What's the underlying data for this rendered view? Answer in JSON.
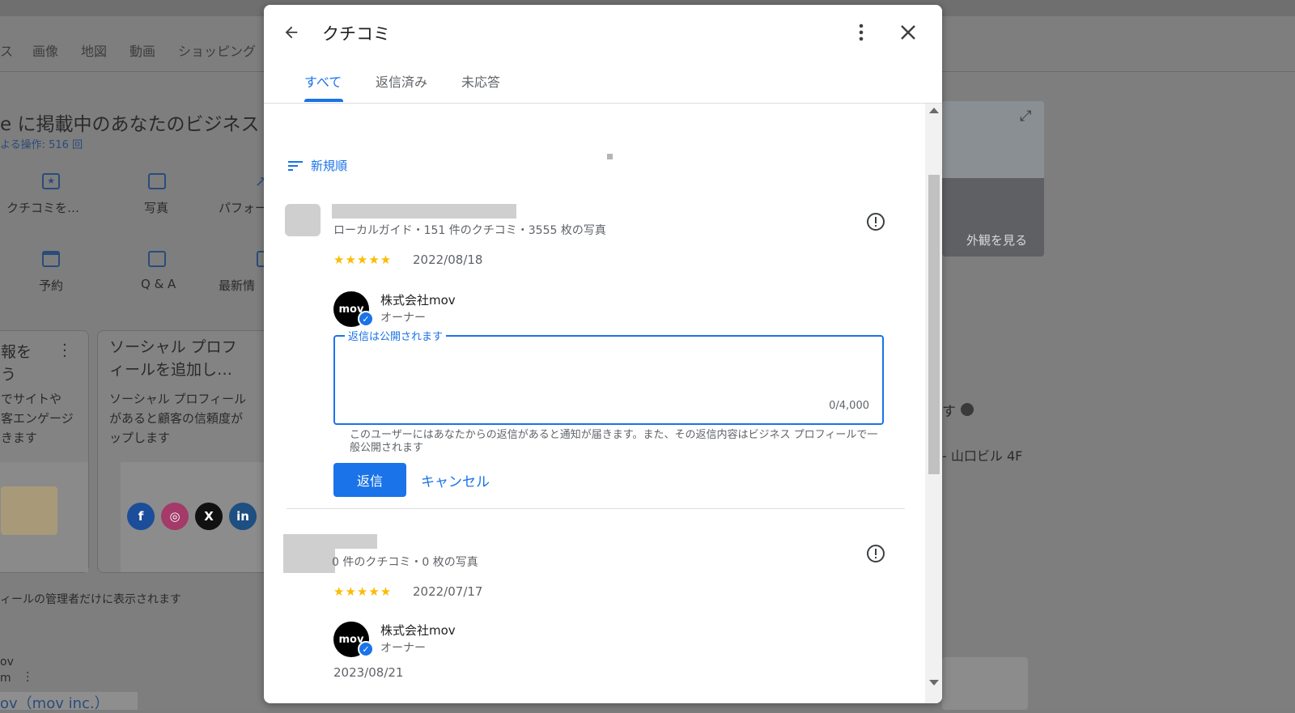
{
  "background": {
    "nav_tabs": [
      "ス",
      "画像",
      "地図",
      "動画",
      "ショッピング"
    ],
    "heading": "e に掲載中のあなたのビジネス",
    "actions_count": "よる操作: 516 回",
    "tiles": [
      {
        "icon": "review-icon",
        "label": "クチコミを…"
      },
      {
        "icon": "photo-icon",
        "label": "写真"
      },
      {
        "icon": "performance-icon",
        "label": "パフォー"
      },
      {
        "icon": "calendar-icon",
        "label": "予約"
      },
      {
        "icon": "qa-icon",
        "label": "Q & A"
      },
      {
        "icon": "post-icon",
        "label": "最新情"
      }
    ],
    "card_left": {
      "title": "報を\nう",
      "body": "でサイトや\n客エンゲージ\nきます"
    },
    "card_social": {
      "title": "ソーシャル プロフ\nィールを追加し…",
      "body": "ソーシャル プロフィール\nがあると顧客の信頼度が\nップします"
    },
    "social_icons": [
      "facebook-icon",
      "instagram-icon",
      "x-icon",
      "linkedin-icon"
    ],
    "footer_note": "ィールの管理者だけに表示されます",
    "bottom_left_1": "ov",
    "bottom_left_2": "m",
    "bottom_link": "ov（mov inc.）",
    "map_label": "外観を見る",
    "right_text_1": "す",
    "right_text_2": "- 山口ビル 4F"
  },
  "dialog": {
    "title": "クチコミ",
    "tabs": [
      {
        "label": "すべて",
        "active": true
      },
      {
        "label": "返信済み",
        "active": false
      },
      {
        "label": "未応答",
        "active": false
      }
    ],
    "sort_label": "新規順",
    "reviews": [
      {
        "meta": "ローカルガイド・151 件のクチコミ・3555 枚の写真",
        "rating": 5,
        "stars": "★★★★★",
        "date": "2022/08/18",
        "owner_name": "株式会社mov",
        "owner_role": "オーナー",
        "owner_avatar_text": "mov",
        "reply_label": "返信は公開されます",
        "reply_value": "",
        "reply_count": "0/4,000",
        "reply_note": "このユーザーにはあなたからの返信があると通知が届きます。また、その返信内容はビジネス プロフィールで一般公開されます",
        "reply_button": "返信",
        "cancel_button": "キャンセル"
      },
      {
        "meta": "0 件のクチコミ・0 枚の写真",
        "rating": 5,
        "stars": "★★★★★",
        "date": "2022/07/17",
        "owner_name": "株式会社mov",
        "owner_role": "オーナー",
        "owner_avatar_text": "mov",
        "reply_date": "2023/08/21"
      }
    ]
  },
  "colors": {
    "accent": "#1a73e8",
    "star": "#fbbc04",
    "overlay": "#7e7e7e"
  }
}
